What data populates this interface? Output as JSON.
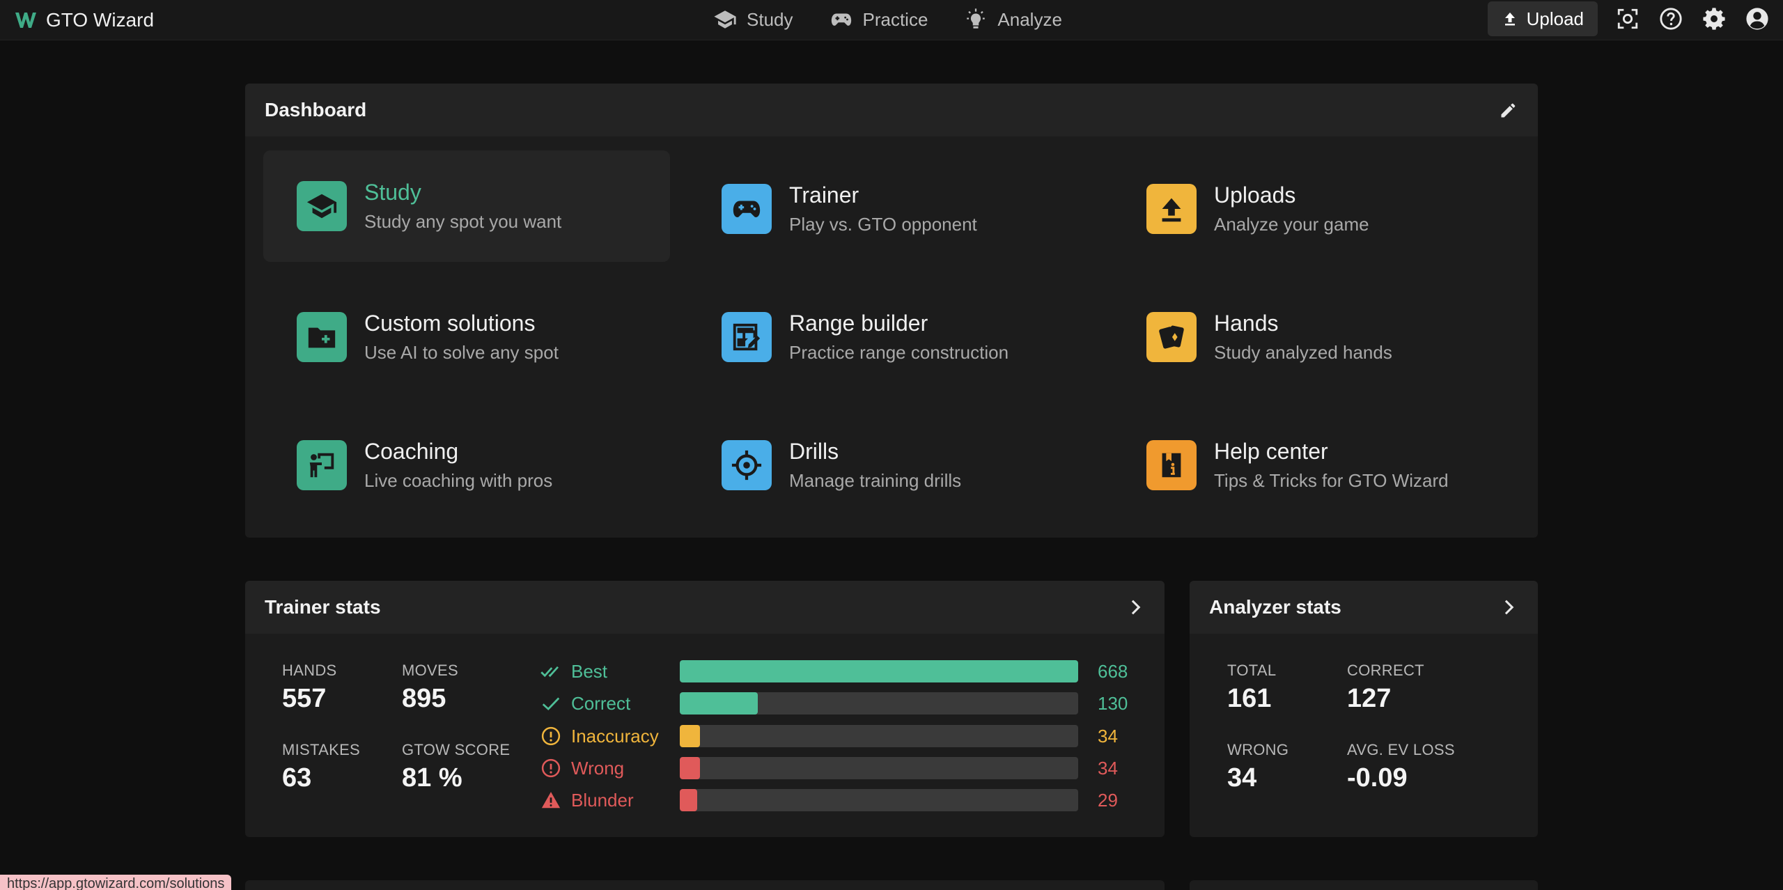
{
  "brand": {
    "name": "GTO Wizard",
    "logo_color": "#3fab87"
  },
  "nav": [
    {
      "label": "Study",
      "icon": "graduation-cap-icon"
    },
    {
      "label": "Practice",
      "icon": "gamepad-icon"
    },
    {
      "label": "Analyze",
      "icon": "lightbulb-icon"
    }
  ],
  "topbar": {
    "upload_label": "Upload"
  },
  "dashboard": {
    "title": "Dashboard",
    "tiles": [
      {
        "title": "Study",
        "subtitle": "Study any spot you want",
        "icon": "graduation-cap-icon",
        "color": "#3fab87",
        "active": true
      },
      {
        "title": "Trainer",
        "subtitle": "Play vs. GTO opponent",
        "icon": "gamepad-icon",
        "color": "#4aaee8"
      },
      {
        "title": "Uploads",
        "subtitle": "Analyze your game",
        "icon": "upload-icon",
        "color": "#f0b53c"
      },
      {
        "title": "Custom solutions",
        "subtitle": "Use AI to solve any spot",
        "icon": "folder-plus-icon",
        "color": "#3fab87"
      },
      {
        "title": "Range builder",
        "subtitle": "Practice range construction",
        "icon": "grid-edit-icon",
        "color": "#4aaee8"
      },
      {
        "title": "Hands",
        "subtitle": "Study analyzed hands",
        "icon": "cards-icon",
        "color": "#f0b53c"
      },
      {
        "title": "Coaching",
        "subtitle": "Live coaching with pros",
        "icon": "presenter-icon",
        "color": "#3fab87"
      },
      {
        "title": "Drills",
        "subtitle": "Manage training drills",
        "icon": "crosshair-icon",
        "color": "#4aaee8"
      },
      {
        "title": "Help center",
        "subtitle": "Tips & Tricks for GTO Wizard",
        "icon": "info-book-icon",
        "color": "#f09a2e"
      }
    ]
  },
  "trainer_stats": {
    "title": "Trainer stats",
    "hands_label": "HANDS",
    "hands_value": "557",
    "moves_label": "MOVES",
    "moves_value": "895",
    "mistakes_label": "MISTAKES",
    "mistakes_value": "63",
    "gtow_label": "GTOW SCORE",
    "gtow_value": "81 %",
    "bars": [
      {
        "label": "Best",
        "count": "668",
        "fraction": 1.0,
        "color": "#4fbf98",
        "icon": "double-check-icon"
      },
      {
        "label": "Correct",
        "count": "130",
        "fraction": 0.195,
        "color": "#4fbf98",
        "icon": "check-icon"
      },
      {
        "label": "Inaccuracy",
        "count": "34",
        "fraction": 0.051,
        "color": "#f0b53c",
        "icon": "info-circle-icon"
      },
      {
        "label": "Wrong",
        "count": "34",
        "fraction": 0.051,
        "color": "#e05a5a",
        "icon": "alert-circle-icon"
      },
      {
        "label": "Blunder",
        "count": "29",
        "fraction": 0.043,
        "color": "#e05a5a",
        "icon": "warning-triangle-icon"
      }
    ]
  },
  "analyzer_stats": {
    "title": "Analyzer stats",
    "total_label": "TOTAL",
    "total_value": "161",
    "correct_label": "CORRECT",
    "correct_value": "127",
    "wrong_label": "WRONG",
    "wrong_value": "34",
    "ev_label": "AVG. EV LOSS",
    "ev_value": "-0.09"
  },
  "status_url": "https://app.gtowizard.com/solutions"
}
